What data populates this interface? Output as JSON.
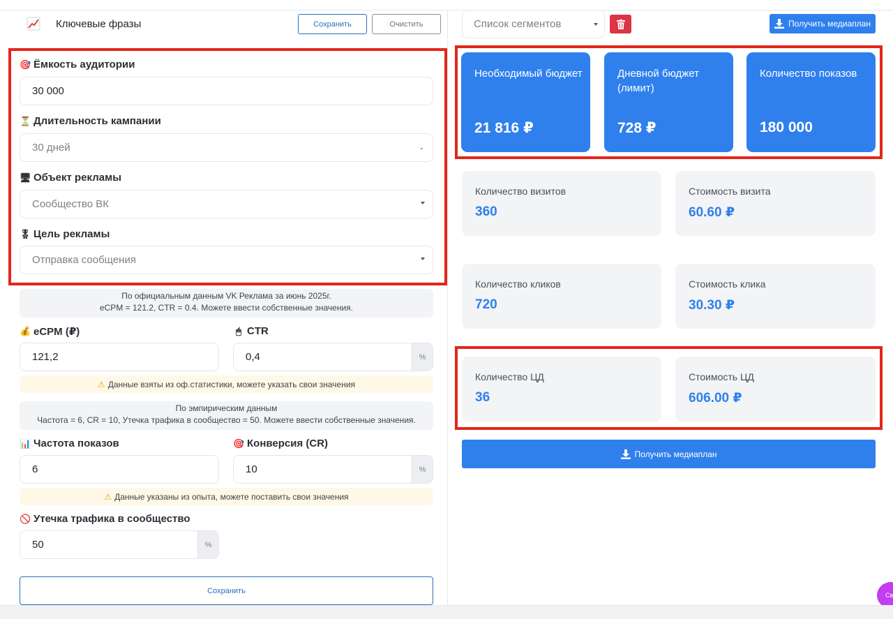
{
  "header": {
    "keywords_icon": "chart-increasing-icon",
    "keywords_title": "Ключевые фразы",
    "save_label": "Сохранить",
    "clear_label": "Очистить"
  },
  "form": {
    "audience": {
      "emoji": "🎯",
      "label": "Ёмкость аудитории",
      "value": "30 000"
    },
    "duration": {
      "emoji": "⏳",
      "label": "Длительность кампании",
      "value": "30 дней"
    },
    "object": {
      "emoji": "🖥",
      "label": "Объект рекламы",
      "value": "Сообщество ВК"
    },
    "goal": {
      "emoji": "🎖",
      "label": "Цель рекламы",
      "value": "Отправка сообщения"
    },
    "official_note": {
      "line1": "По официальным данным VK Реклама за июнь 2025г.",
      "line2": "eCPM = 121.2, CTR = 0.4. Можете ввести собственные значения."
    },
    "ecpm": {
      "emoji": "💰",
      "label": "eCPM (₽)",
      "value": "121,2"
    },
    "ctr": {
      "emoji": "🖱",
      "label": "CTR",
      "value": "0,4",
      "suffix": "%"
    },
    "official_warning": "Данные взяты из оф.статистики, можете указать свои значения",
    "empirical_note": {
      "line1": "По эмпирическим данным",
      "line2": "Частота = 6, CR = 10, Утечка трафика в сообщество = 50. Можете ввести собственные значения."
    },
    "frequency": {
      "emoji": "📊",
      "label": "Частота показов",
      "value": "6"
    },
    "conversion": {
      "emoji": "🎯",
      "label": "Конверсия (CR)",
      "value": "10",
      "suffix": "%"
    },
    "experience_warning": "Данные указаны из опыта, можете поставить свои значения",
    "leak": {
      "emoji": "🚫",
      "label": "Утечка трафика в сообщество",
      "value": "50",
      "suffix": "%"
    },
    "save_label": "Сохранить"
  },
  "right": {
    "segments_placeholder": "Список сегментов",
    "mediaplan_label": "Получить медиаплан",
    "highlight_cards": [
      {
        "label": "Необходимый бюджет",
        "value": "21 816 ₽"
      },
      {
        "label": "Дневной бюджет (лимит)",
        "value": "728 ₽"
      },
      {
        "label": "Количество показов",
        "value": "180 000"
      }
    ],
    "stats": {
      "visits": {
        "label": "Количество визитов",
        "value": "360"
      },
      "visit_cost": {
        "label": "Стоимость визита",
        "value": "60.60 ₽"
      },
      "clicks": {
        "label": "Количество кликов",
        "value": "720"
      },
      "click_cost": {
        "label": "Стоимость клика",
        "value": "30.30 ₽"
      },
      "targets": {
        "label": "Количество ЦД",
        "value": "36"
      },
      "target_cost": {
        "label": "Стоимость ЦД",
        "value": "606.00 ₽"
      }
    },
    "mediaplan_bottom_label": "Получить медиаплан"
  },
  "chat": {
    "label": "Св"
  },
  "colors": {
    "accent": "#2f80ed",
    "danger": "#dc3545",
    "highlight": "#e3261b"
  }
}
